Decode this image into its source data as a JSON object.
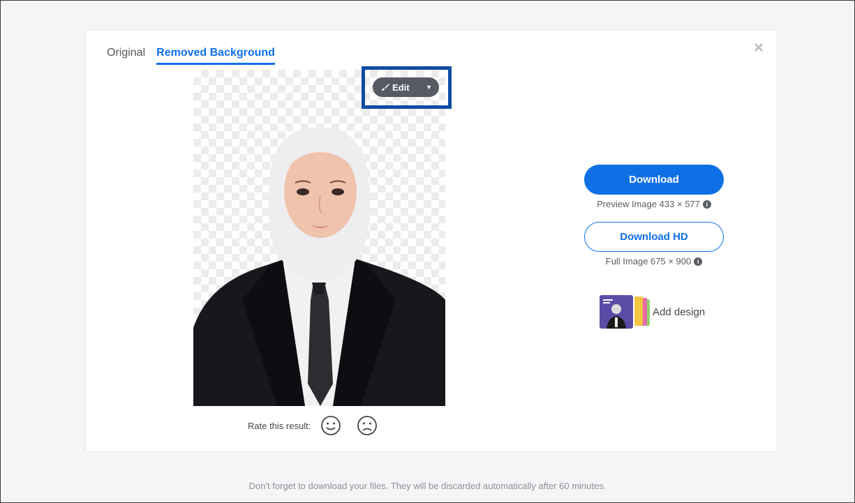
{
  "tabs": [
    {
      "label": "Original",
      "active": false
    },
    {
      "label": "Removed Background",
      "active": true
    }
  ],
  "close_icon": "close-icon",
  "edit_button": {
    "label": "Edit",
    "icon": "brush-icon",
    "menu_icon": "caret-down-icon"
  },
  "rating": {
    "label": "Rate this result:",
    "positive_icon": "smile-icon",
    "negative_icon": "frown-icon"
  },
  "download": {
    "label": "Download",
    "meta": "Preview Image 433 × 577"
  },
  "download_hd": {
    "label": "Download HD",
    "meta": "Full Image 675 × 900"
  },
  "add_design": {
    "label": "Add design"
  },
  "footer": "Don't forget to download your files. They will be discarded automatically after 60 minutes.",
  "colors": {
    "accent": "#0f70e6",
    "highlight_border": "#0e4da0",
    "edit_button_bg": "#555a63"
  }
}
